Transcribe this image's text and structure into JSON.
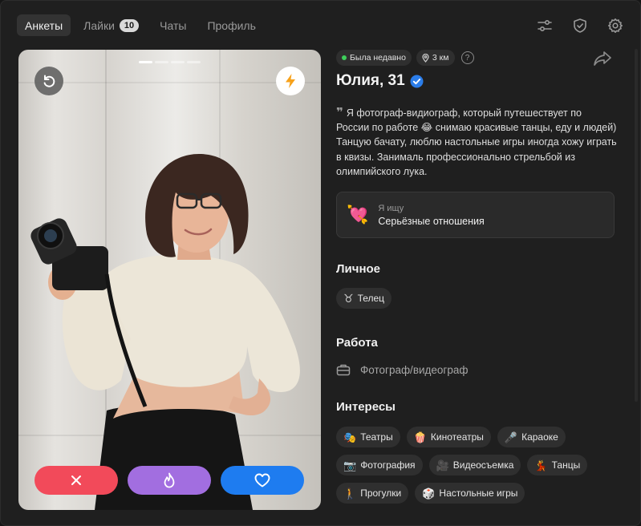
{
  "tabs": [
    {
      "label": "Анкеты",
      "active": true
    },
    {
      "label": "Лайки",
      "badge": "10"
    },
    {
      "label": "Чаты"
    },
    {
      "label": "Профиль"
    }
  ],
  "top_icons": [
    "sliders-icon",
    "shield-check-icon",
    "gear-icon"
  ],
  "photo": {
    "pages": 4,
    "current_page": 1,
    "undo_icon": "undo-icon",
    "boost_icon": "lightning-icon"
  },
  "actions": {
    "dislike_icon": "close-icon",
    "superlike_icon": "flame-icon",
    "like_icon": "heart-icon"
  },
  "profile": {
    "status": "Была недавно",
    "distance": "3 км",
    "help": "?",
    "name": "Юлия, 31",
    "verified": true,
    "bio_line1": "Я фотограф-видиограф, который путешествует по России по работе 😂 снимаю красивые танцы, еду и людей)",
    "bio_line2": "Танцую бачату, люблю настольные игры иногда хожу играть в квизы. Занималь профессионально стрельбой из олимпийского лука.",
    "seeking_label": "Я ищу",
    "seeking_value": "Серьёзные отношения",
    "seeking_emoji": "💘"
  },
  "sections": {
    "personal_title": "Личное",
    "zodiac_icon": "♉",
    "zodiac": "Телец",
    "work_title": "Работа",
    "work_value": "Фотограф/видеограф",
    "interests_title": "Интересы"
  },
  "interests": [
    {
      "emoji": "🎭",
      "label": "Театры"
    },
    {
      "emoji": "🍿",
      "label": "Кинотеатры"
    },
    {
      "emoji": "🎤",
      "label": "Караоке"
    },
    {
      "emoji": "📷",
      "label": "Фотография"
    },
    {
      "emoji": "🎥",
      "label": "Видеосъемка"
    },
    {
      "emoji": "💃",
      "label": "Танцы"
    },
    {
      "emoji": "🚶",
      "label": "Прогулки"
    },
    {
      "emoji": "🎲",
      "label": "Настольные игры"
    }
  ],
  "colors": {
    "background": "#1f1f1f",
    "dislike": "#f24a5a",
    "superlike": "#a26ee0",
    "like": "#1e7cf0",
    "online": "#3ecf5b",
    "verified": "#2b7de9"
  }
}
